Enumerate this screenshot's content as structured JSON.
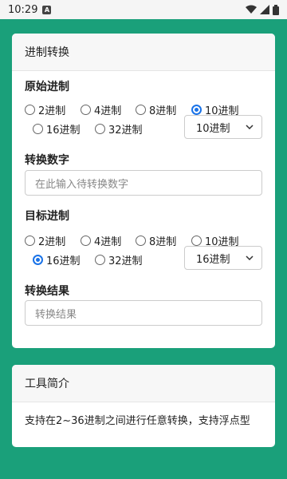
{
  "status_bar": {
    "time": "10:29",
    "icons": [
      "a-badge-icon",
      "wifi-icon",
      "signal-icon",
      "battery-icon"
    ]
  },
  "converter": {
    "title": "进制转换",
    "source_label": "原始进制",
    "target_label": "目标进制",
    "number_label": "转换数字",
    "number_placeholder": "在此输入待转换数字",
    "result_label": "转换结果",
    "result_placeholder": "转换结果",
    "radix_options": [
      "2进制",
      "4进制",
      "8进制",
      "10进制",
      "16进制",
      "32进制"
    ],
    "source_selected": "10进制",
    "source_select_value": "10进制",
    "target_selected": "16进制",
    "target_select_value": "16进制"
  },
  "intro": {
    "title": "工具简介",
    "text": "支持在2~36进制之间进行任意转换，支持浮点型"
  },
  "colors": {
    "background": "#1aa07a",
    "accent": "#1a73e8"
  }
}
